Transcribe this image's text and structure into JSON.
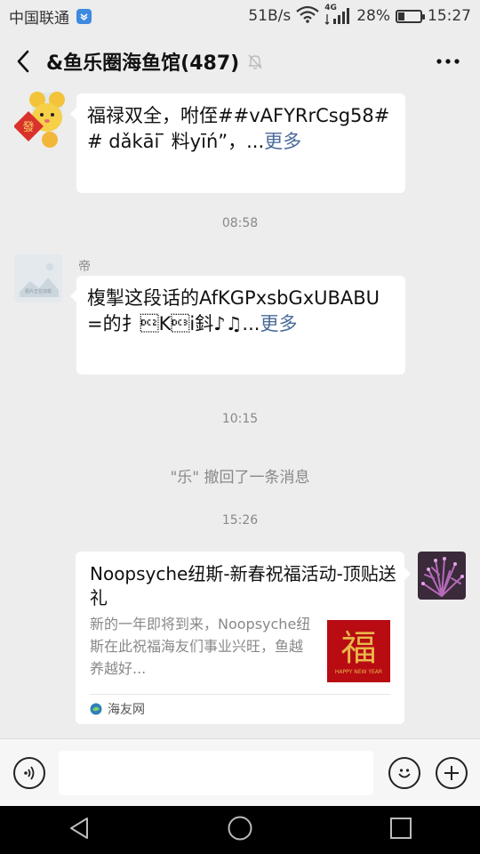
{
  "status_bar": {
    "carrier": "中国联通",
    "net_speed": "51B/s",
    "network_type": "4G",
    "battery_percent": "28%",
    "battery_level": 0.28,
    "time": "15:27"
  },
  "header": {
    "title": "&鱼乐圈海鱼馆(487)"
  },
  "messages": [
    {
      "text": "福禄双全，咐侄##vAFYRrCsg58## dǎkāi ̄ 料yīń”，...",
      "more": "更多"
    },
    {
      "sender": "帝",
      "text": "椱掣这段话的AfKGPxsbGxUBABU=的扌\u0012K\u0013i鈄♪♫...",
      "more": "更多",
      "avatar_caption": "图片正在加载"
    }
  ],
  "timestamps": [
    "08:58",
    "10:15",
    "15:26"
  ],
  "recall_notice": "\"乐\" 撤回了一条消息",
  "link_card": {
    "title": "Noopsyche纽斯-新春祝福活动-顶贴送礼",
    "description": "新的一年即将到来，Noopsyche纽斯在此祝福海友们事业兴旺，鱼越养越好...",
    "thumb_char": "福",
    "thumb_caption": "HAPPY NEW YEAR",
    "source": "海友网"
  },
  "input_bar": {
    "value": ""
  },
  "colors": {
    "background": "#ededed",
    "link_more": "#4a6a9a",
    "thumb_red": "#b80b12",
    "thumb_gold": "#e8b84a"
  }
}
